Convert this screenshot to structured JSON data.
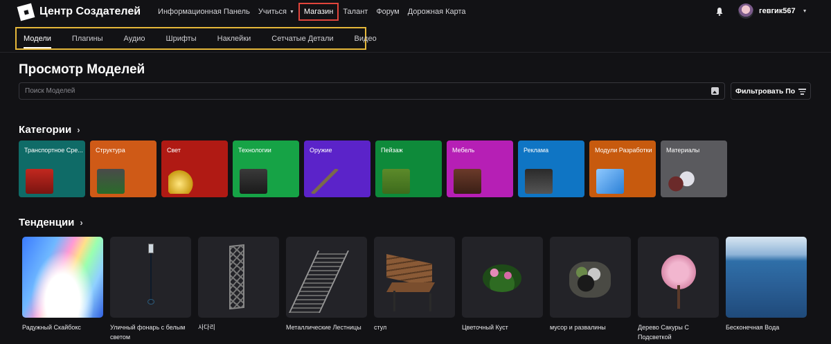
{
  "header": {
    "logo_text": "Центр Создателей",
    "nav": [
      {
        "label": "Информационная Панель"
      },
      {
        "label": "Учиться",
        "has_dropdown": true
      },
      {
        "label": "Магазин",
        "active": true
      },
      {
        "label": "Талант"
      },
      {
        "label": "Форум"
      },
      {
        "label": "Дорожная Карта"
      }
    ],
    "user": {
      "name": "гевгик567"
    }
  },
  "tabs": [
    "Модели",
    "Плагины",
    "Аудио",
    "Шрифты",
    "Наклейки",
    "Сетчатые Детали",
    "Видео"
  ],
  "selected_tab": "Модели",
  "page_title": "Просмотр Моделей",
  "search": {
    "placeholder": "Поиск Моделей"
  },
  "filter_label": "Фильтровать По",
  "categories_title": "Категории",
  "categories": [
    {
      "label": "Транспортное Сре...",
      "color": "#0f6b67"
    },
    {
      "label": "Структура",
      "color": "#cf5a17"
    },
    {
      "label": "Свет",
      "color": "#b01a14"
    },
    {
      "label": "Технологии",
      "color": "#16a346"
    },
    {
      "label": "Оружие",
      "color": "#5b23c9"
    },
    {
      "label": "Пейзаж",
      "color": "#0e8a3a"
    },
    {
      "label": "Мебель",
      "color": "#b61fb5"
    },
    {
      "label": "Реклама",
      "color": "#0f75c4"
    },
    {
      "label": "Модули Разработки",
      "color": "#c75a0e"
    },
    {
      "label": "Материалы",
      "color": "#5a5a5e"
    }
  ],
  "trending_title": "Тенденции",
  "trending": [
    {
      "label": "Радужный Скайбокс"
    },
    {
      "label": "Уличный фонарь с белым светом"
    },
    {
      "label": "사다리"
    },
    {
      "label": "Металлические Лестницы"
    },
    {
      "label": "стул"
    },
    {
      "label": "Цветочный Куст"
    },
    {
      "label": "мусор и развалины"
    },
    {
      "label": "Дерево Сакуры С Подсветкой"
    },
    {
      "label": "Бесконечная Вода"
    }
  ]
}
